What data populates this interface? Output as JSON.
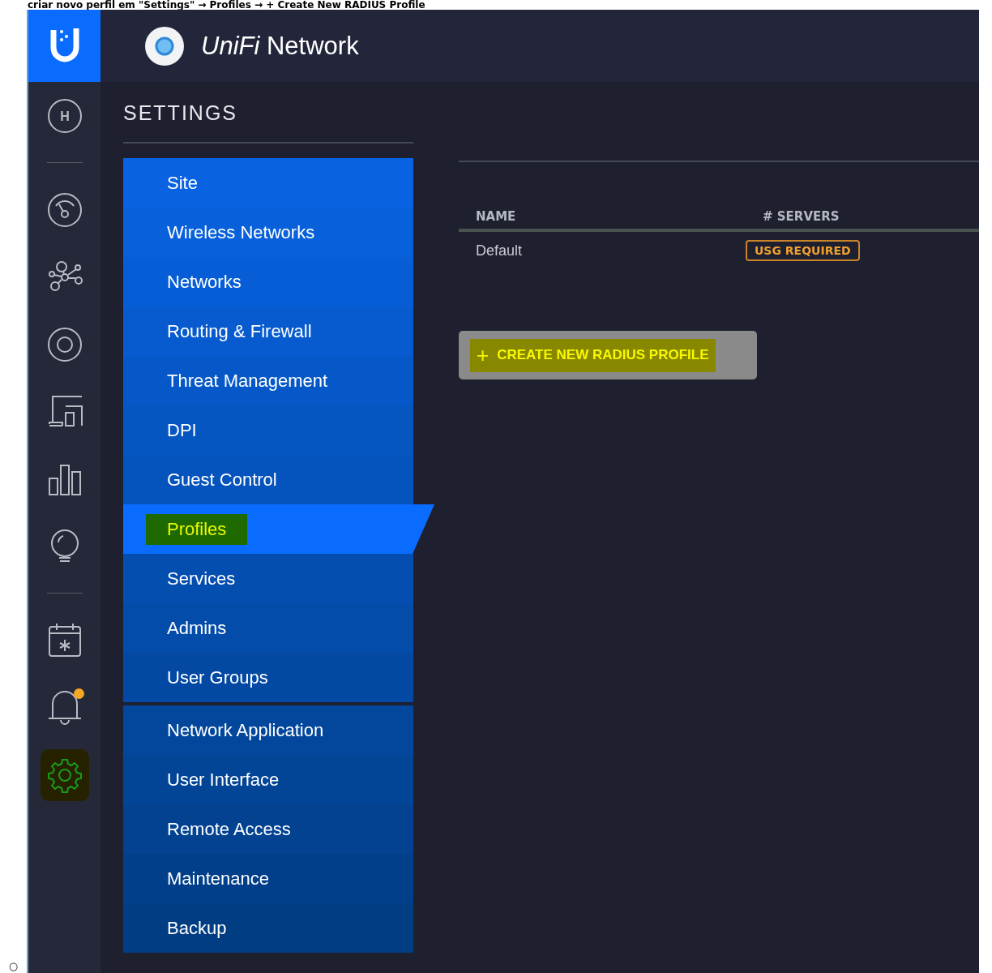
{
  "caption": "criar novo perfil em \"Settings\" → Profiles → + Create New RADIUS Profile",
  "bullet": "○",
  "header": {
    "title_brand": "UniFi",
    "title_product": "Network"
  },
  "rail": [
    {
      "kind": "home",
      "label": "H",
      "selected": false
    },
    {
      "kind": "divider"
    },
    {
      "kind": "dashboard",
      "selected": false
    },
    {
      "kind": "topology",
      "selected": false
    },
    {
      "kind": "devices",
      "selected": false
    },
    {
      "kind": "clients",
      "selected": false
    },
    {
      "kind": "statistics",
      "selected": false
    },
    {
      "kind": "insights",
      "selected": false
    },
    {
      "kind": "divider"
    },
    {
      "kind": "events",
      "selected": false
    },
    {
      "kind": "alerts",
      "selected": false,
      "badge": true
    },
    {
      "kind": "settings",
      "selected": true,
      "highlighted": true
    }
  ],
  "settings": {
    "heading": "SETTINGS",
    "groups": [
      [
        {
          "label": "Site",
          "selected": false
        },
        {
          "label": "Wireless Networks",
          "selected": false
        },
        {
          "label": "Networks",
          "selected": false
        },
        {
          "label": "Routing & Firewall",
          "selected": false
        },
        {
          "label": "Threat Management",
          "selected": false
        },
        {
          "label": "DPI",
          "selected": false
        },
        {
          "label": "Guest Control",
          "selected": false
        },
        {
          "label": "Profiles",
          "selected": true,
          "highlighted": true
        },
        {
          "label": "Services",
          "selected": false
        },
        {
          "label": "Admins",
          "selected": false
        },
        {
          "label": "User Groups",
          "selected": false
        }
      ],
      [
        {
          "label": "Network Application",
          "selected": false
        },
        {
          "label": "User Interface",
          "selected": false
        },
        {
          "label": "Remote Access",
          "selected": false
        },
        {
          "label": "Maintenance",
          "selected": false
        },
        {
          "label": "Backup",
          "selected": false
        }
      ]
    ]
  },
  "table": {
    "columns": [
      "NAME",
      "# SERVERS"
    ],
    "rows": [
      {
        "name": "Default",
        "servers": "USG REQUIRED"
      }
    ]
  },
  "create_button": {
    "icon": "+",
    "label": "CREATE NEW RADIUS PROFILE",
    "highlighted": true
  }
}
